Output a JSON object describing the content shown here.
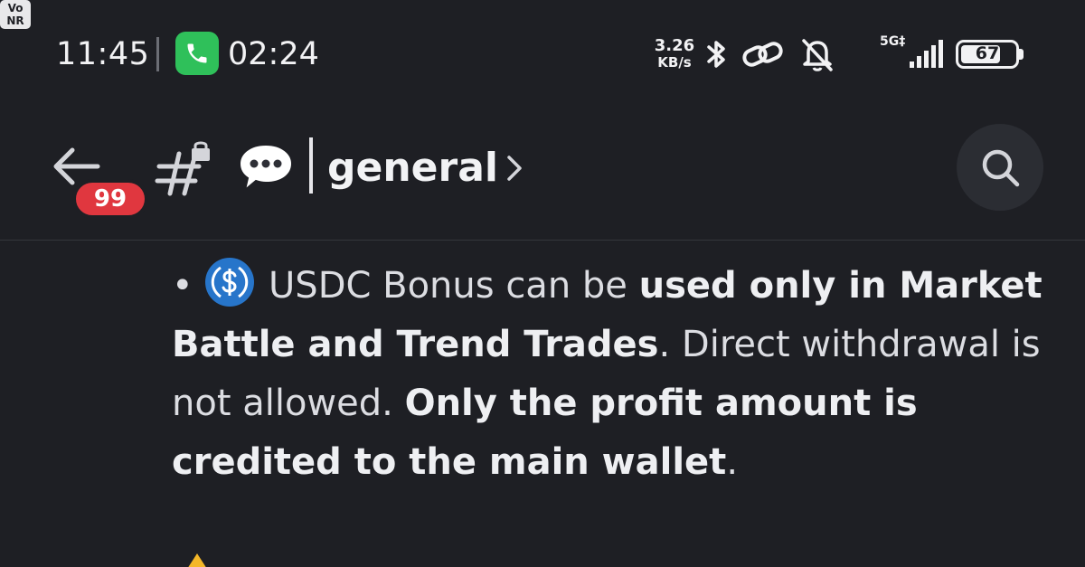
{
  "status_bar": {
    "time": "11:45",
    "call_duration": "02:24",
    "net_speed_value": "3.26",
    "net_speed_unit": "KB/s",
    "vonr_line1": "Vo",
    "vonr_line2": "NR",
    "network_type": "5G‡",
    "battery_level": "67",
    "icons": [
      "phone-icon",
      "bluetooth-icon",
      "hotspot-link-icon",
      "bell-muted-icon",
      "signal-icon",
      "battery-icon"
    ]
  },
  "header": {
    "unread_count": "99",
    "channel_name": "general",
    "channel_emoji": "💬",
    "icons": [
      "back-arrow-icon",
      "locked-channel-icon",
      "chevron-right-icon",
      "search-icon"
    ]
  },
  "message": {
    "bullet": "•",
    "seg1": " USDC Bonus can be ",
    "seg2_bold": "used only in Market Battle and Trend Trades",
    "seg3": ". Direct withdrawal is not allowed. ",
    "seg4_bold": "Only the profit amount is credited to the main wallet",
    "seg5": ".",
    "emoji": "usdc-coin-icon"
  },
  "colors": {
    "background": "#1e1f24",
    "badge": "#e0373f",
    "call_pill": "#2fc05a",
    "usdc_blue": "#2775ca"
  }
}
